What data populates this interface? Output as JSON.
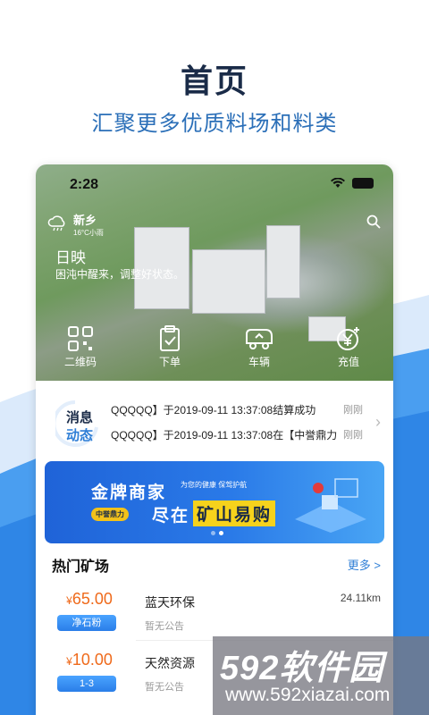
{
  "hero": {
    "title": "首页",
    "subtitle": "汇聚更多优质料场和料类"
  },
  "status": {
    "time": "2:28"
  },
  "weather": {
    "city": "新乡",
    "temp": "16°C小雨"
  },
  "greeting": {
    "line1": "日映",
    "line2": "困沌中醒来，调整好状态。"
  },
  "quick_actions": [
    {
      "label": "二维码",
      "icon": "qrcode-icon"
    },
    {
      "label": "下单",
      "icon": "clipboard-icon"
    },
    {
      "label": "车辆",
      "icon": "truck-icon"
    },
    {
      "label": "充值",
      "icon": "yen-coin-icon"
    }
  ],
  "news": {
    "tag_line1": "消息",
    "tag_line2": "动态",
    "rows": [
      {
        "text": "QQQQQ】于2019-09-11 13:37:08结算成功",
        "ago": "刚刚"
      },
      {
        "text": "QQQQQ】于2019-09-11 13:37:08在【中誉鼎力",
        "ago": "刚刚"
      }
    ]
  },
  "banner": {
    "line1": "金牌商家",
    "slogan": "为您的健康 保驾护航",
    "tag": "中誉鼎力",
    "line2_prefix": "尽在",
    "line2_highlight": "矿山易购"
  },
  "hot": {
    "title": "热门矿场",
    "more": "更多 >"
  },
  "items": [
    {
      "currency": "¥",
      "price": "65.00",
      "category": "净石粉",
      "name": "蓝天环保",
      "note": "暂无公告",
      "distance": "24.11km"
    },
    {
      "currency": "¥",
      "price": "10.00",
      "category": "1-3",
      "name": "天然资源",
      "note": "暂无公告",
      "distance": ""
    }
  ],
  "watermark": {
    "text": "592软件园",
    "url": "www.592xiazai.com"
  },
  "colors": {
    "accent": "#2e7ed6",
    "price": "#ef6a1b",
    "title": "#1a2b48"
  }
}
